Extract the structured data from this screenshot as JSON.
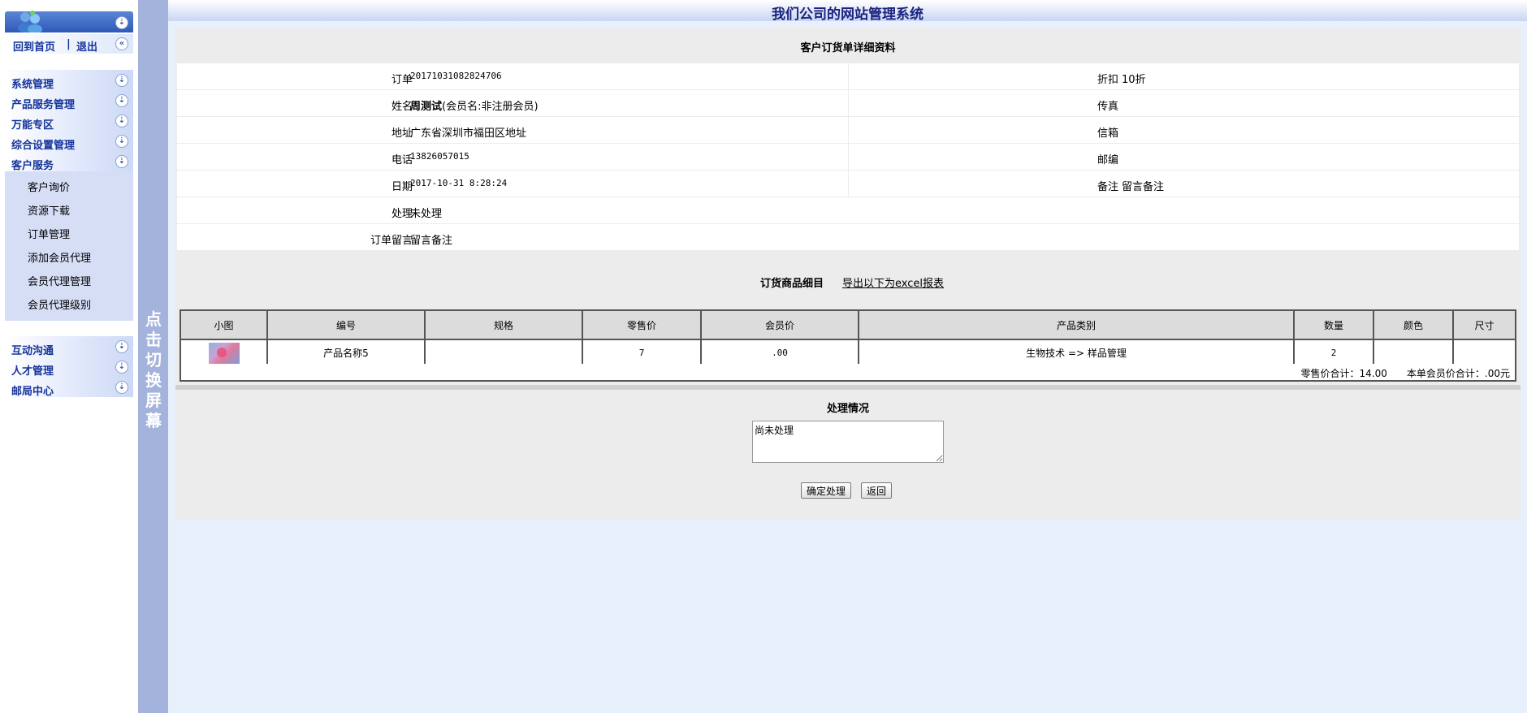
{
  "sidebar": {
    "home_link": "回到首页",
    "separator": "|",
    "logout_link": "退出",
    "menus": [
      {
        "label": "系统管理"
      },
      {
        "label": "产品服务管理"
      },
      {
        "label": "万能专区"
      },
      {
        "label": "综合设置管理"
      },
      {
        "label": "客户服务"
      }
    ],
    "customer_service_items": [
      "客户询价",
      "资源下载",
      "订单管理",
      "添加会员代理",
      "会员代理管理",
      "会员代理级别"
    ],
    "menus_bottom": [
      {
        "label": "互动沟通"
      },
      {
        "label": "人才管理"
      },
      {
        "label": "邮局中心"
      }
    ]
  },
  "toggle_text": "点击切换屏幕",
  "header": {
    "title": "我们公司的网站管理系统"
  },
  "order": {
    "title": "客户订货单详细资料",
    "rows": [
      {
        "label1": "订单",
        "value1": "20171031082824706",
        "label2": "折扣",
        "value2": "10折"
      },
      {
        "label1": "姓名",
        "value1_bold": "周测试",
        "value1": "(会员名:非注册会员)",
        "label2": "传真",
        "value2": ""
      },
      {
        "label1": "地址",
        "value1": "广东省深圳市福田区地址",
        "label2": "信箱",
        "value2": ""
      },
      {
        "label1": "电话",
        "value1": "13826057015",
        "label2": "邮编",
        "value2": ""
      },
      {
        "label1": "日期",
        "value1": "2017-10-31 8:28:24",
        "label2": "备注",
        "value2": "留言备注"
      },
      {
        "label1": "处理",
        "value1": "未处理"
      },
      {
        "label1": "订单留言",
        "value1": "留言备注"
      }
    ]
  },
  "items": {
    "title": "订货商品细目",
    "export_link": "导出以下为excel报表",
    "headers": [
      "小图",
      "编号",
      "规格",
      "零售价",
      "会员价",
      "产品类别",
      "数量",
      "颜色",
      "尺寸"
    ],
    "rows": [
      {
        "name": "产品名称5",
        "spec": "",
        "retail": "7",
        "member": ".00",
        "category": "生物技术 => 样品管理",
        "qty": "2",
        "color": "",
        "size": ""
      }
    ],
    "totals": "零售价合计：14.00　　本单会员价合计：.00元"
  },
  "processing": {
    "title": "处理情况",
    "text": "尚未处理",
    "confirm_button": "确定处理",
    "back_button": "返回"
  }
}
